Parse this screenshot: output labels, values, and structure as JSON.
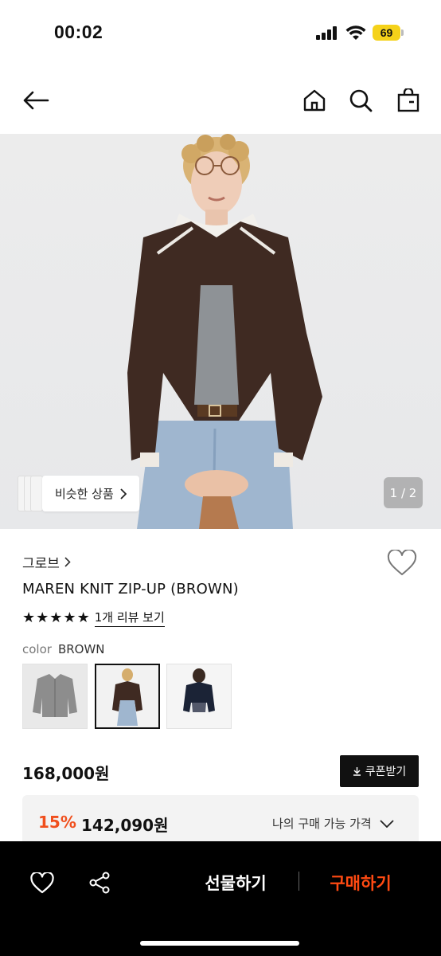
{
  "status_bar": {
    "time": "00:02",
    "battery_level": "69",
    "battery_color": "#f5d21a"
  },
  "nav": {
    "back_icon": "arrow-left-icon",
    "home_icon": "home-icon",
    "search_icon": "search-icon",
    "bag_icon": "shopping-bag-icon"
  },
  "gallery": {
    "similar_label": "비슷한 상품",
    "page_indicator": "1 / 2",
    "current_page": 1,
    "total_pages": 2
  },
  "product": {
    "brand": "그로브",
    "name": "MAREN KNIT ZIP-UP (BROWN)",
    "rating_stars": 5,
    "review_link": "1개 리뷰 보기",
    "color_label": "color",
    "color_value": "BROWN",
    "swatches": [
      {
        "name": "grey",
        "selected": false
      },
      {
        "name": "brown",
        "selected": true
      },
      {
        "name": "navy",
        "selected": false
      }
    ],
    "price": "168,000원",
    "coupon_label": "쿠폰받기",
    "discount_percent": "15%",
    "discount_price": "142,090원",
    "my_price_label": "나의 구매 가능 가격"
  },
  "bottom_bar": {
    "gift_label": "선물하기",
    "buy_label": "구매하기",
    "accent": "#ff4a12"
  },
  "colors": {
    "discount": "#f04f1d",
    "black": "#111111"
  }
}
